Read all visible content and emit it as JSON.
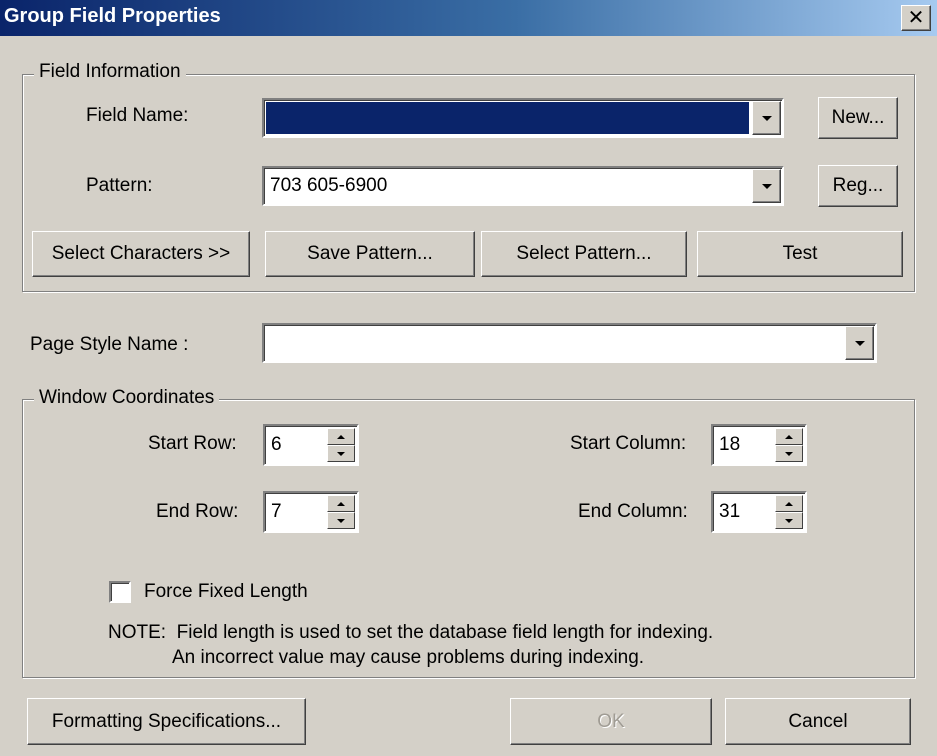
{
  "window": {
    "title": "Group Field Properties",
    "close_glyph": "✕"
  },
  "field_information": {
    "legend": "Field Information",
    "field_name_label": "Field Name:",
    "field_name_value": "",
    "pattern_label": "Pattern:",
    "pattern_value": "703 605-6900",
    "new_button": "New...",
    "reg_button": "Reg...",
    "select_characters_button": "Select Characters >>",
    "save_pattern_button": "Save Pattern...",
    "select_pattern_button": "Select Pattern...",
    "test_button": "Test"
  },
  "page_style": {
    "label": "Page Style Name :",
    "value": ""
  },
  "window_coordinates": {
    "legend": "Window Coordinates",
    "start_row_label": "Start Row:",
    "start_row_value": "6",
    "end_row_label": "End Row:",
    "end_row_value": "7",
    "start_column_label": "Start Column:",
    "start_column_value": "18",
    "end_column_label": "End Column:",
    "end_column_value": "31",
    "force_fixed_length_label": "Force Fixed Length",
    "force_fixed_length_checked": false,
    "note_line1": "NOTE:  Field length is used to set the database field length for indexing.",
    "note_line2": "An incorrect value may cause problems during indexing."
  },
  "footer": {
    "formatting_button": "Formatting Specifications...",
    "ok_button": "OK",
    "cancel_button": "Cancel"
  },
  "colors": {
    "dialog_bg": "#d4d0c8",
    "title_bar_start": "#0a246a",
    "title_bar_end": "#a6caf0",
    "selection": "#0a246a"
  }
}
